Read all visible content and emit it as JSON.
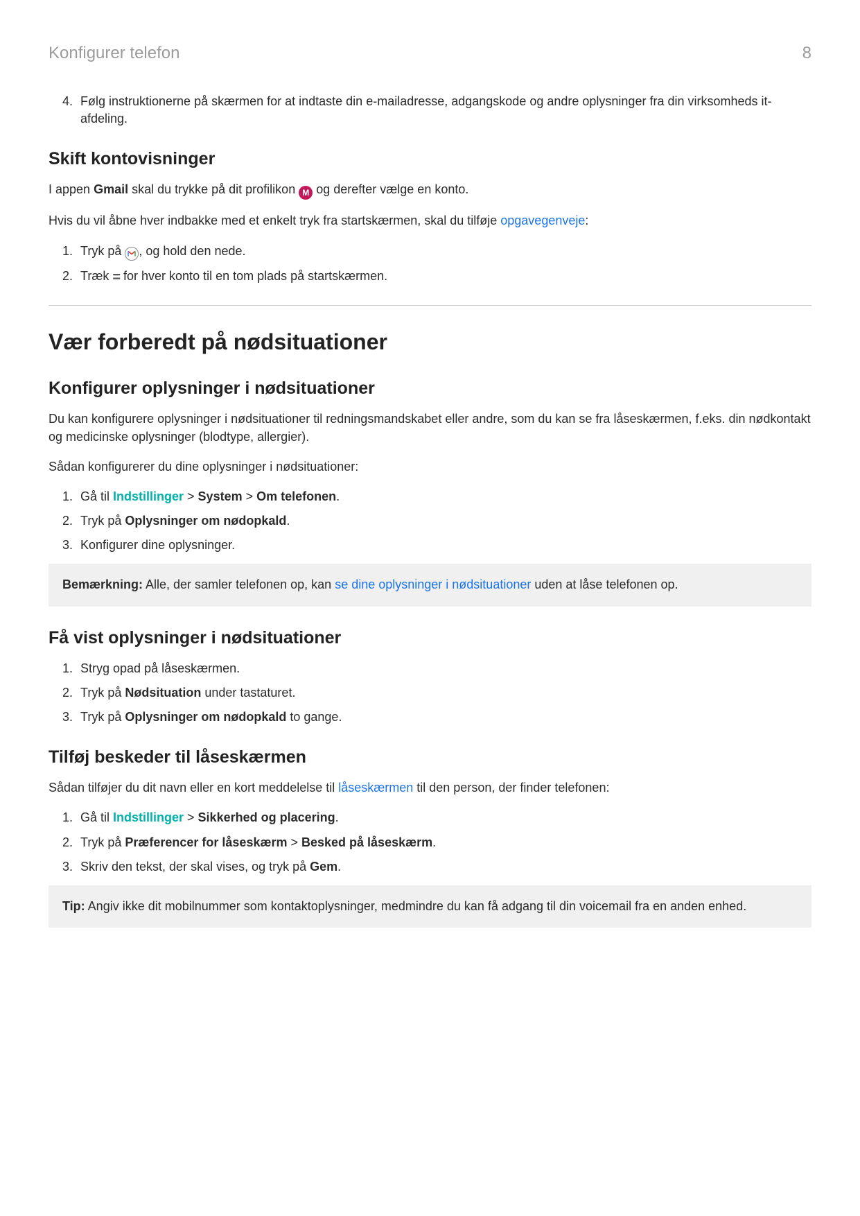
{
  "header": {
    "title": "Konfigurer telefon",
    "page": "8"
  },
  "step4": {
    "num": "4.",
    "text": "Følg instruktionerne på skærmen for at indtaste din e-mailadresse, adgangskode og andre oplysninger fra din virksomheds it-afdeling."
  },
  "sec_skift": {
    "heading": "Skift kontovisninger",
    "p1a": "I appen ",
    "p1b": "Gmail",
    "p1c": " skal du trykke på dit profilikon ",
    "p1d": " og derefter vælge en konto.",
    "p2a": "Hvis du vil åbne hver indbakke med et enkelt tryk fra startskærmen, skal du tilføje ",
    "p2link": "opgavegenveje",
    "p2b": ":",
    "li1a": "Tryk på ",
    "li1b": ", og hold den nede.",
    "li2a": "Træk ",
    "li2b": " for hver konto til en tom plads på startskærmen."
  },
  "sec_emerg": {
    "h1": "Vær forberedt på nødsituationer",
    "h2a": "Konfigurer oplysninger i nødsituationer",
    "p1": "Du kan konfigurere oplysninger i nødsituationer til redningsmandskabet eller andre, som du kan se fra låseskærmen, f.eks. din nødkontakt og medicinske oplysninger (blodtype, allergier).",
    "p2": "Sådan konfigurerer du dine oplysninger i nødsituationer:",
    "li1a": "Gå til ",
    "li1b": "Indstillinger",
    "li1c": " > ",
    "li1d": "System",
    "li1e": " > ",
    "li1f": "Om telefonen",
    "li1g": ".",
    "li2a": "Tryk på ",
    "li2b": "Oplysninger om nødopkald",
    "li2c": ".",
    "li3": "Konfigurer dine oplysninger.",
    "note_label": "Bemærkning:",
    "note_a": " Alle, der samler telefonen op, kan ",
    "note_link": "se dine oplysninger i nødsituationer",
    "note_b": " uden at låse telefonen op."
  },
  "sec_view": {
    "h2": "Få vist oplysninger i nødsituationer",
    "li1": "Stryg opad på låseskærmen.",
    "li2a": "Tryk på ",
    "li2b": "Nødsituation",
    "li2c": " under tastaturet.",
    "li3a": "Tryk på ",
    "li3b": "Oplysninger om nødopkald",
    "li3c": " to gange."
  },
  "sec_lock": {
    "h2": "Tilføj beskeder til låseskærmen",
    "p1a": "Sådan tilføjer du dit navn eller en kort meddelelse til ",
    "p1link": "låseskærmen",
    "p1b": " til den person, der finder telefonen:",
    "li1a": "Gå til ",
    "li1b": "Indstillinger",
    "li1c": " > ",
    "li1d": "Sikkerhed og placering",
    "li1e": ".",
    "li2a": "Tryk på ",
    "li2b": "Præferencer for låseskærm",
    "li2c": " > ",
    "li2d": "Besked på låseskærm",
    "li2e": ".",
    "li3a": "Skriv den tekst, der skal vises, og tryk på ",
    "li3b": "Gem",
    "li3c": ".",
    "tip_label": "Tip:",
    "tip_text": " Angiv ikke dit mobilnummer som kontaktoplysninger, medmindre du kan få adgang til din voicemail fra en anden enhed."
  }
}
